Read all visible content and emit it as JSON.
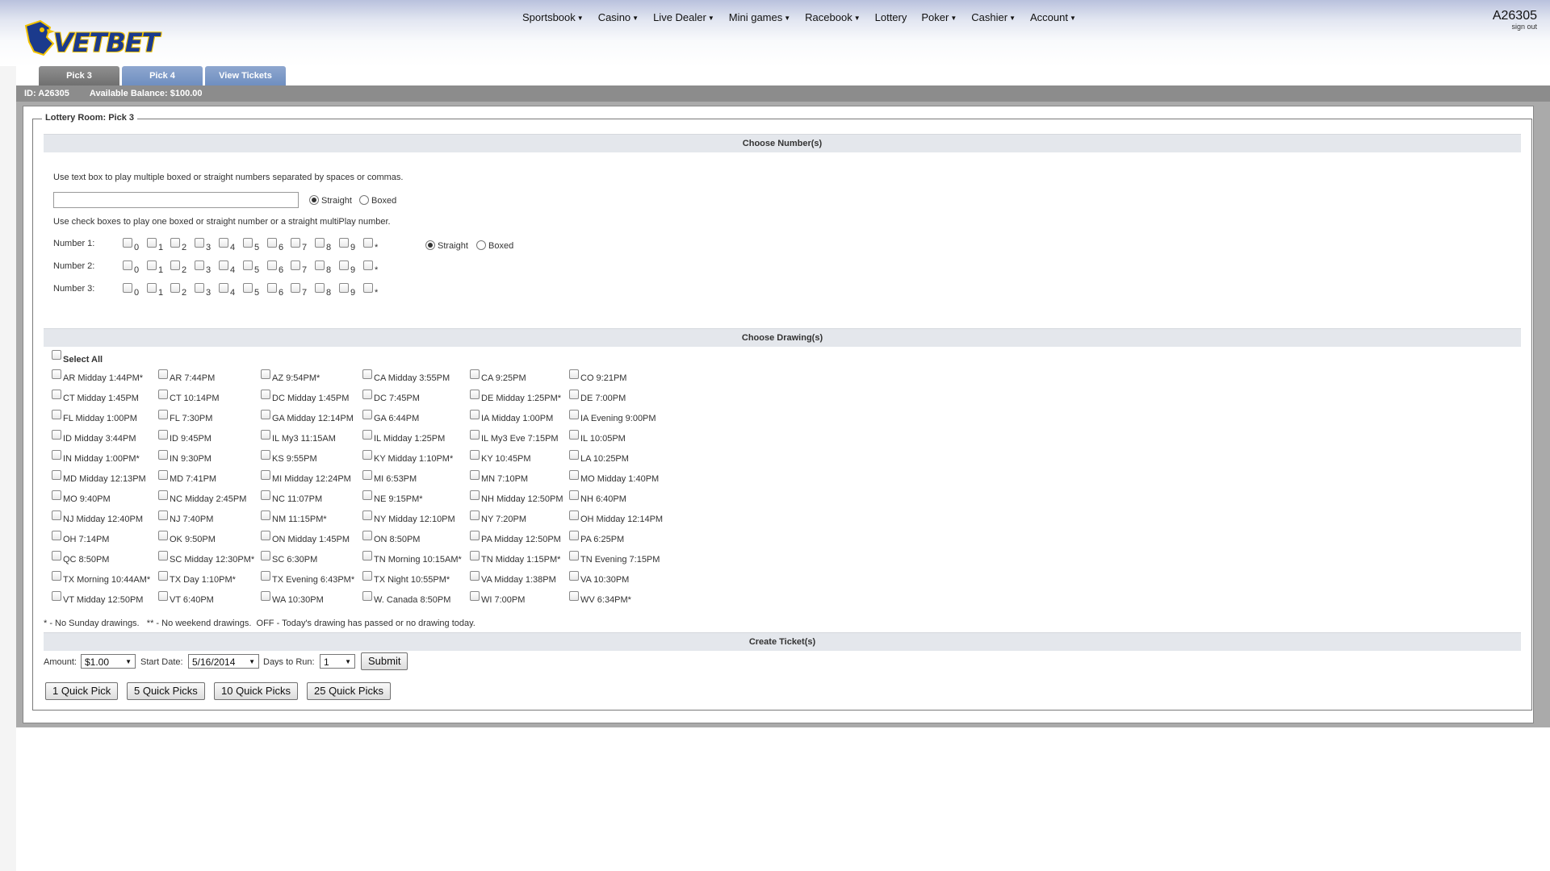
{
  "brand": {
    "logo_text": "VETBET"
  },
  "nav": [
    {
      "label": "Sportsbook",
      "caret": true
    },
    {
      "label": "Casino",
      "caret": true
    },
    {
      "label": "Live Dealer",
      "caret": true
    },
    {
      "label": "Mini games",
      "caret": true
    },
    {
      "label": "Racebook",
      "caret": true
    },
    {
      "label": "Lottery",
      "caret": false
    },
    {
      "label": "Poker",
      "caret": true
    },
    {
      "label": "Cashier",
      "caret": true
    },
    {
      "label": "Account",
      "caret": true
    }
  ],
  "user": {
    "id": "A26305",
    "sign_out": "sign out"
  },
  "tabs": [
    {
      "label": "Pick 3",
      "active": true
    },
    {
      "label": "Pick 4",
      "active": false
    },
    {
      "label": "View Tickets",
      "active": false
    }
  ],
  "infobar": {
    "id_text": "ID: A26305",
    "balance_text": "Available Balance: $100.00"
  },
  "room": {
    "legend": "Lottery Room: Pick 3"
  },
  "choose_numbers": {
    "title": "Choose Number(s)",
    "text_instruction": "Use text box to play multiple boxed or straight numbers separated by spaces or commas.",
    "text_value": "",
    "straight_label": "Straight",
    "boxed_label": "Boxed",
    "checkbox_instruction": "Use check boxes to play one boxed or straight number or a straight multiPlay number.",
    "rows": [
      "Number 1:",
      "Number 2:",
      "Number 3:"
    ],
    "digits": [
      "0",
      "1",
      "2",
      "3",
      "4",
      "5",
      "6",
      "7",
      "8",
      "9",
      "*"
    ]
  },
  "choose_drawings": {
    "title": "Choose Drawing(s)",
    "select_all": "Select All",
    "columns": [
      [
        "AR Midday 1:44PM*",
        "CT Midday 1:45PM",
        "FL Midday 1:00PM",
        "ID Midday 3:44PM",
        "IN Midday 1:00PM*",
        "MD Midday 12:13PM",
        "MO 9:40PM",
        "NJ Midday 12:40PM",
        "OH 7:14PM",
        "QC 8:50PM",
        "TX Morning 10:44AM*",
        "VT Midday 12:50PM"
      ],
      [
        "AR 7:44PM",
        "CT 10:14PM",
        "FL 7:30PM",
        "ID 9:45PM",
        "IN 9:30PM",
        "MD 7:41PM",
        "NC Midday 2:45PM",
        "NJ 7:40PM",
        "OK 9:50PM",
        "SC Midday 12:30PM*",
        "TX Day 1:10PM*",
        "VT 6:40PM"
      ],
      [
        "AZ 9:54PM*",
        "DC Midday 1:45PM",
        "GA Midday 12:14PM",
        "IL My3 11:15AM",
        "KS 9:55PM",
        "MI Midday 12:24PM",
        "NC 11:07PM",
        "NM 11:15PM*",
        "ON Midday 1:45PM",
        "SC 6:30PM",
        "TX Evening 6:43PM*",
        "WA 10:30PM"
      ],
      [
        "CA Midday 3:55PM",
        "DC 7:45PM",
        "GA 6:44PM",
        "IL Midday 1:25PM",
        "KY Midday 1:10PM*",
        "MI 6:53PM",
        "NE 9:15PM*",
        "NY Midday 12:10PM",
        "ON 8:50PM",
        "TN Morning 10:15AM*",
        "TX Night 10:55PM*",
        "W. Canada 8:50PM"
      ],
      [
        "CA 9:25PM",
        "DE Midday 1:25PM*",
        "IA Midday 1:00PM",
        "IL My3 Eve 7:15PM",
        "KY 10:45PM",
        "MN 7:10PM",
        "NH Midday 12:50PM",
        "NY 7:20PM",
        "PA Midday 12:50PM",
        "TN Midday 1:15PM*",
        "VA Midday 1:38PM",
        "WI 7:00PM"
      ],
      [
        "CO 9:21PM",
        "DE 7:00PM",
        "IA Evening 9:00PM",
        "IL 10:05PM",
        "LA 10:25PM",
        "MO Midday 1:40PM",
        "NH 6:40PM",
        "OH Midday 12:14PM",
        "PA 6:25PM",
        "TN Evening 7:15PM",
        "VA 10:30PM",
        "WV 6:34PM*"
      ]
    ],
    "footnote": "* - No Sunday drawings.   ** - No weekend drawings.  OFF - Today's drawing has passed or no drawing today."
  },
  "create_tickets": {
    "title": "Create Ticket(s)",
    "amount_label": "Amount:",
    "amount_value": "$1.00",
    "start_date_label": "Start Date:",
    "start_date_value": "5/16/2014",
    "days_label": "Days to Run:",
    "days_value": "1",
    "submit_label": "Submit",
    "quick_picks": [
      "1 Quick Pick",
      "5 Quick Picks",
      "10 Quick Picks",
      "25 Quick Picks"
    ]
  },
  "colors": {
    "tab_active": "#808080",
    "tab_inactive": "#7f9cc8",
    "bar_gray": "#8c8c8c",
    "section_bar": "#e4e7ec",
    "brand_blue": "#1b3a8c",
    "brand_yellow": "#f2c200"
  },
  "icons": {
    "dropdown": "caret-down-icon",
    "logo": "bird-mascot-icon"
  }
}
